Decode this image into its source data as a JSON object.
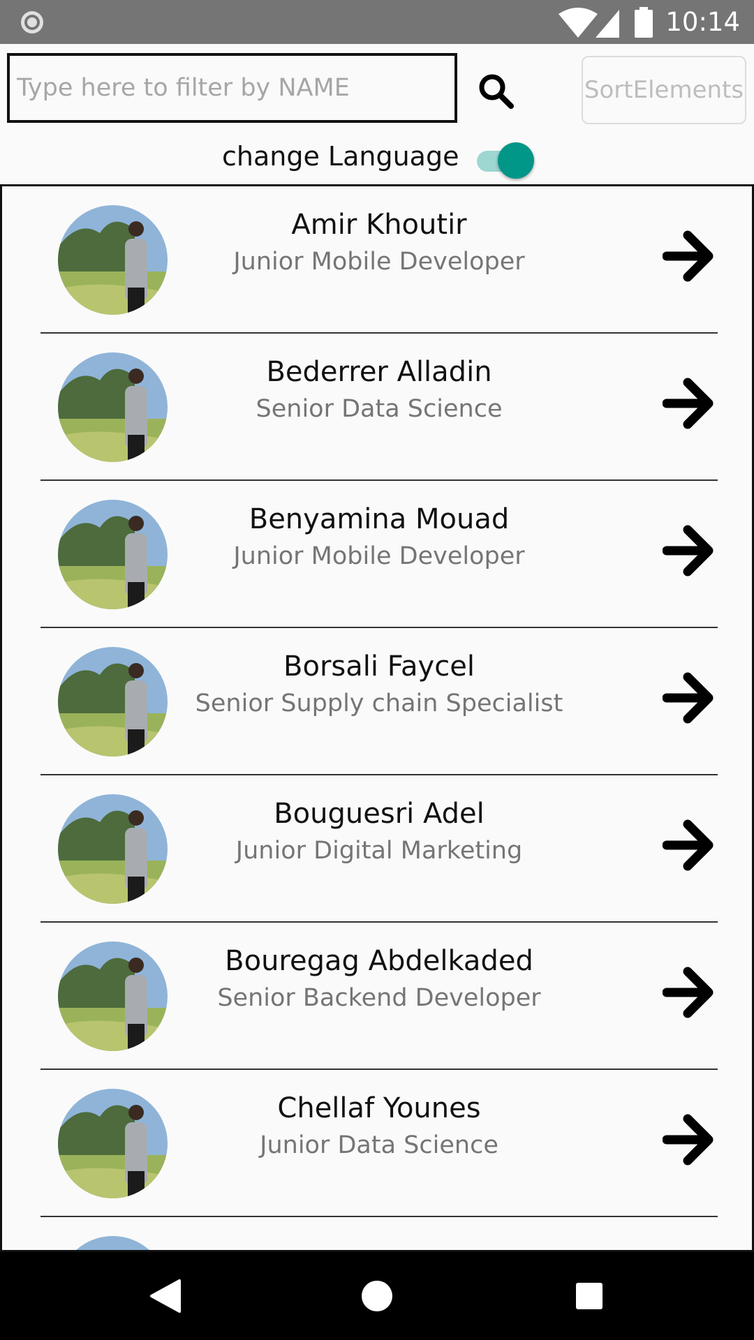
{
  "status_bar": {
    "time": "10:14",
    "icons": [
      "notification-dot-icon",
      "wifi-icon",
      "cell-signal-icon",
      "battery-icon"
    ]
  },
  "search": {
    "placeholder": "Type here to filter by NAME",
    "value": "",
    "icon": "search-icon"
  },
  "sort_button": {
    "label": "SortElements"
  },
  "language": {
    "label": "change Language",
    "toggle_on": true,
    "accent_color": "#009688"
  },
  "contacts": [
    {
      "name": "Amir Khoutir",
      "role": "Junior Mobile Developer"
    },
    {
      "name": "Bederrer Alladin",
      "role": "Senior Data Science"
    },
    {
      "name": "Benyamina Mouad",
      "role": "Junior Mobile Developer"
    },
    {
      "name": "Borsali Faycel",
      "role": "Senior Supply chain Specialist"
    },
    {
      "name": "Bouguesri Adel",
      "role": "Junior Digital Marketing"
    },
    {
      "name": "Bouregag Abdelkaded",
      "role": "Senior Backend Developer"
    },
    {
      "name": "Chellaf Younes",
      "role": "Junior Data Science"
    }
  ],
  "nav_bar": {
    "icons": [
      "back-icon",
      "home-icon",
      "recents-icon"
    ]
  }
}
